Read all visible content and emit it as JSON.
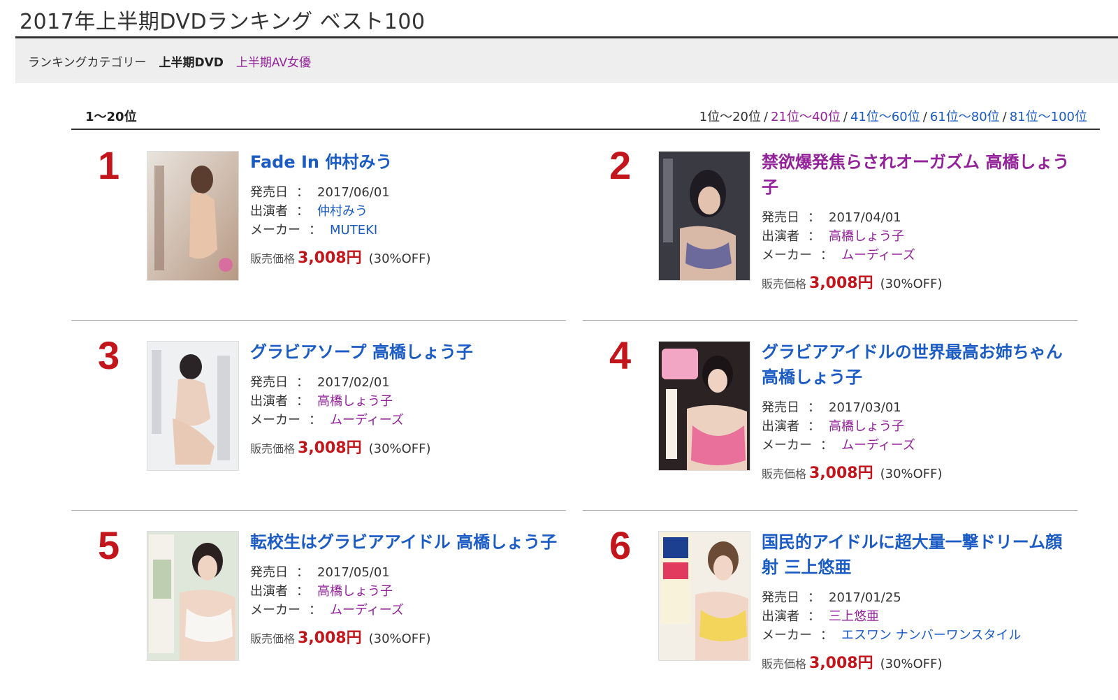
{
  "page": {
    "title": "2017年上半期DVDランキング ベスト100",
    "category_label": "ランキングカテゴリー",
    "category_active": "上半期DVD",
    "category_link": "上半期AV女優",
    "range_label": "1〜20位"
  },
  "pager": [
    {
      "label": "1位〜20位",
      "state": "current"
    },
    {
      "label": "21位〜40位",
      "state": "visited"
    },
    {
      "label": "41位〜60位",
      "state": "link"
    },
    {
      "label": "61位〜80位",
      "state": "link"
    },
    {
      "label": "81位〜100位",
      "state": "link"
    }
  ],
  "labels": {
    "release": "発売日",
    "performer": "出演者",
    "maker": "メーカー",
    "colon": "：",
    "price": "販売価格"
  },
  "items": [
    {
      "rank": "1",
      "title": "Fade In 仲村みう",
      "title_state": "link",
      "release": "2017/06/01",
      "performer": "仲村みう",
      "performer_state": "link",
      "maker": "MUTEKI",
      "maker_state": "link",
      "price": "3,008円",
      "discount": "(30%OFF)"
    },
    {
      "rank": "2",
      "title": "禁欲爆発焦らされオーガズム 高橋しょう子",
      "title_state": "visited",
      "release": "2017/04/01",
      "performer": "高橋しょう子",
      "performer_state": "visited",
      "maker": "ムーディーズ",
      "maker_state": "visited",
      "price": "3,008円",
      "discount": "(30%OFF)"
    },
    {
      "rank": "3",
      "title": "グラビアソープ 高橋しょう子",
      "title_state": "link",
      "release": "2017/02/01",
      "performer": "高橋しょう子",
      "performer_state": "visited",
      "maker": "ムーディーズ",
      "maker_state": "visited",
      "price": "3,008円",
      "discount": "(30%OFF)"
    },
    {
      "rank": "4",
      "title": "グラビアアイドルの世界最高お姉ちゃん 高橋しょう子",
      "title_state": "link",
      "release": "2017/03/01",
      "performer": "高橋しょう子",
      "performer_state": "visited",
      "maker": "ムーディーズ",
      "maker_state": "visited",
      "price": "3,008円",
      "discount": "(30%OFF)"
    },
    {
      "rank": "5",
      "title": "転校生はグラビアアイドル 高橋しょう子",
      "title_state": "link",
      "release": "2017/05/01",
      "performer": "高橋しょう子",
      "performer_state": "visited",
      "maker": "ムーディーズ",
      "maker_state": "visited",
      "price": "3,008円",
      "discount": "(30%OFF)"
    },
    {
      "rank": "6",
      "title": "国民的アイドルに超大量一撃ドリーム顔射 三上悠亜",
      "title_state": "link",
      "release": "2017/01/25",
      "performer": "三上悠亜",
      "performer_state": "visited",
      "maker": "エスワン ナンバーワンスタイル",
      "maker_state": "link",
      "price": "3,008円",
      "discount": "(30%OFF)"
    }
  ],
  "colors": {
    "link": "#1a5bc4",
    "visited": "#93219a",
    "rank": "#c3161c",
    "price": "#c3161c"
  }
}
